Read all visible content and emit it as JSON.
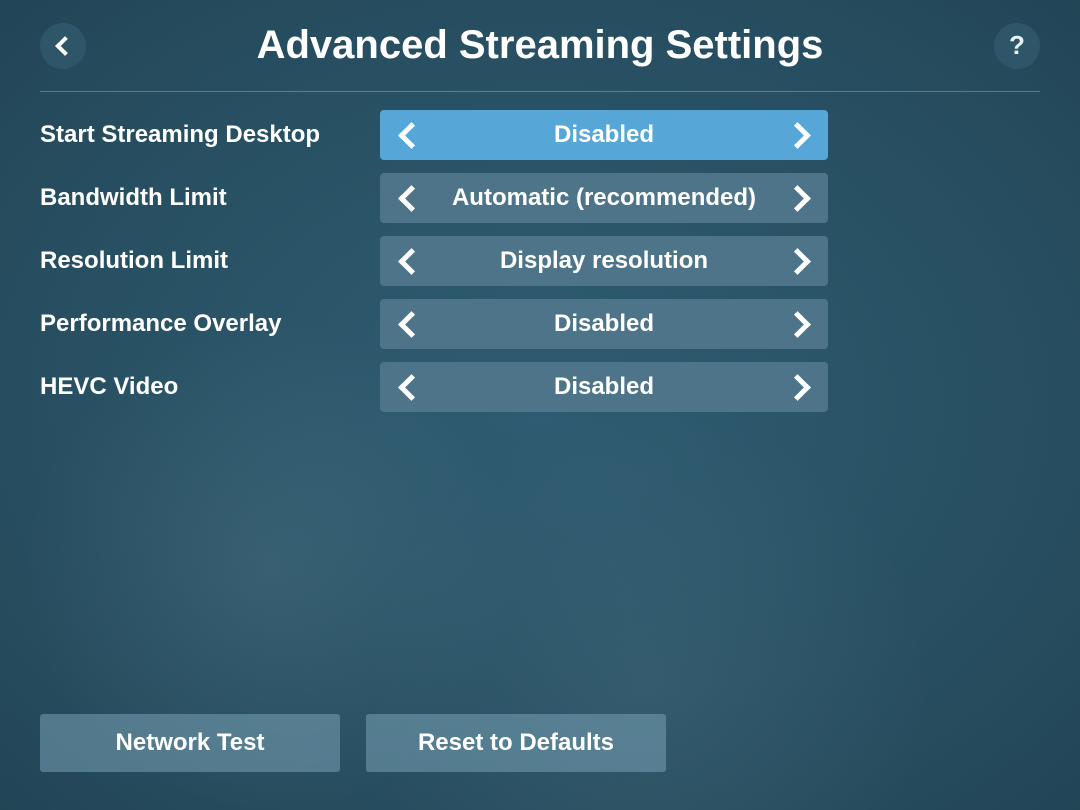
{
  "header": {
    "title": "Advanced Streaming Settings",
    "help_label": "?"
  },
  "settings": [
    {
      "id": "start-streaming-desktop",
      "label": "Start Streaming Desktop",
      "value": "Disabled",
      "selected": true
    },
    {
      "id": "bandwidth-limit",
      "label": "Bandwidth Limit",
      "value": "Automatic (recommended)",
      "selected": false
    },
    {
      "id": "resolution-limit",
      "label": "Resolution Limit",
      "value": "Display resolution",
      "selected": false
    },
    {
      "id": "performance-overlay",
      "label": "Performance Overlay",
      "value": "Disabled",
      "selected": false
    },
    {
      "id": "hevc-video",
      "label": "HEVC Video",
      "value": "Disabled",
      "selected": false
    }
  ],
  "footer": {
    "network_test": "Network Test",
    "reset_defaults": "Reset to Defaults"
  }
}
